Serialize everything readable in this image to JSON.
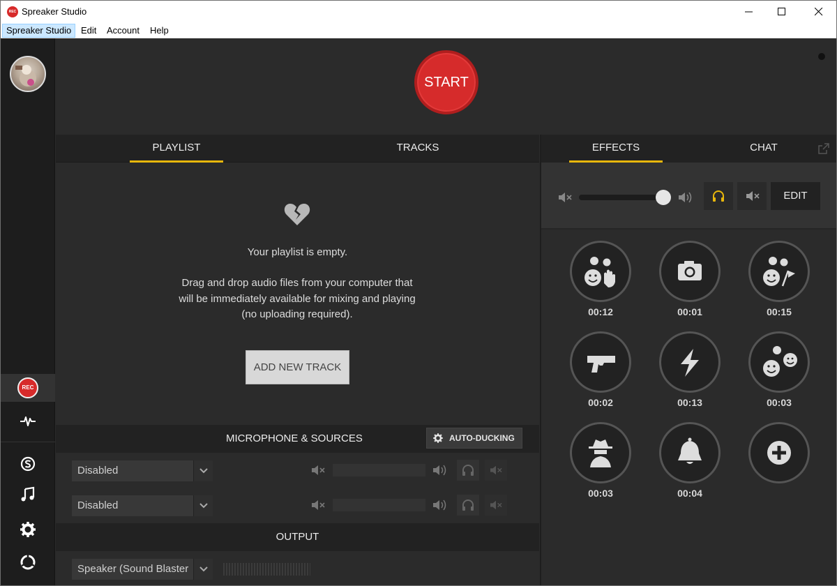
{
  "window": {
    "title": "Spreaker Studio",
    "logo_text": "REC",
    "controls": [
      "minimize",
      "maximize",
      "close"
    ]
  },
  "menu": {
    "items": [
      "Spreaker Studio",
      "Edit",
      "Account",
      "Help"
    ]
  },
  "sidebar": {
    "rec_badge": "REC",
    "icons": [
      "avatar",
      "rec-icon",
      "pulse-icon",
      "skype-icon",
      "music-note-icon",
      "gear-icon",
      "lifebuoy-icon"
    ]
  },
  "header": {
    "start_label": "START"
  },
  "left_tabs": {
    "items": [
      "PLAYLIST",
      "TRACKS"
    ],
    "active": "PLAYLIST"
  },
  "playlist": {
    "empty_title": "Your playlist is empty.",
    "empty_desc": "Drag and drop audio files from your computer that will be immediately available for mixing and playing (no uploading required).",
    "add_button": "ADD NEW TRACK"
  },
  "sources": {
    "title": "MICROPHONE & SOURCES",
    "ducking_label": "AUTO-DUCKING",
    "rows": [
      {
        "selected": "Disabled"
      },
      {
        "selected": "Disabled"
      }
    ]
  },
  "output": {
    "title": "OUTPUT",
    "selected": "Speaker (Sound Blaster"
  },
  "right_tabs": {
    "items": [
      "EFFECTS",
      "CHAT"
    ],
    "active": "EFFECTS"
  },
  "effects": {
    "edit_label": "EDIT",
    "volume_level": 1.0,
    "accent_color": "#e8b70c",
    "pads": [
      {
        "icon": "crowd-applause-icon",
        "time": "00:12"
      },
      {
        "icon": "camera-icon",
        "time": "00:01"
      },
      {
        "icon": "crowd-cheer-icon",
        "time": "00:15"
      },
      {
        "icon": "gun-icon",
        "time": "00:02"
      },
      {
        "icon": "lightning-icon",
        "time": "00:13"
      },
      {
        "icon": "laughter-icon",
        "time": "00:03"
      },
      {
        "icon": "spy-icon",
        "time": "00:03"
      },
      {
        "icon": "bell-icon",
        "time": "00:04"
      },
      {
        "icon": "add-icon",
        "time": ""
      }
    ]
  },
  "colors": {
    "start": "#d62b2b",
    "accent": "#e8b70c",
    "background": "#2b2b2b",
    "sidebar": "#1d1d1d"
  }
}
